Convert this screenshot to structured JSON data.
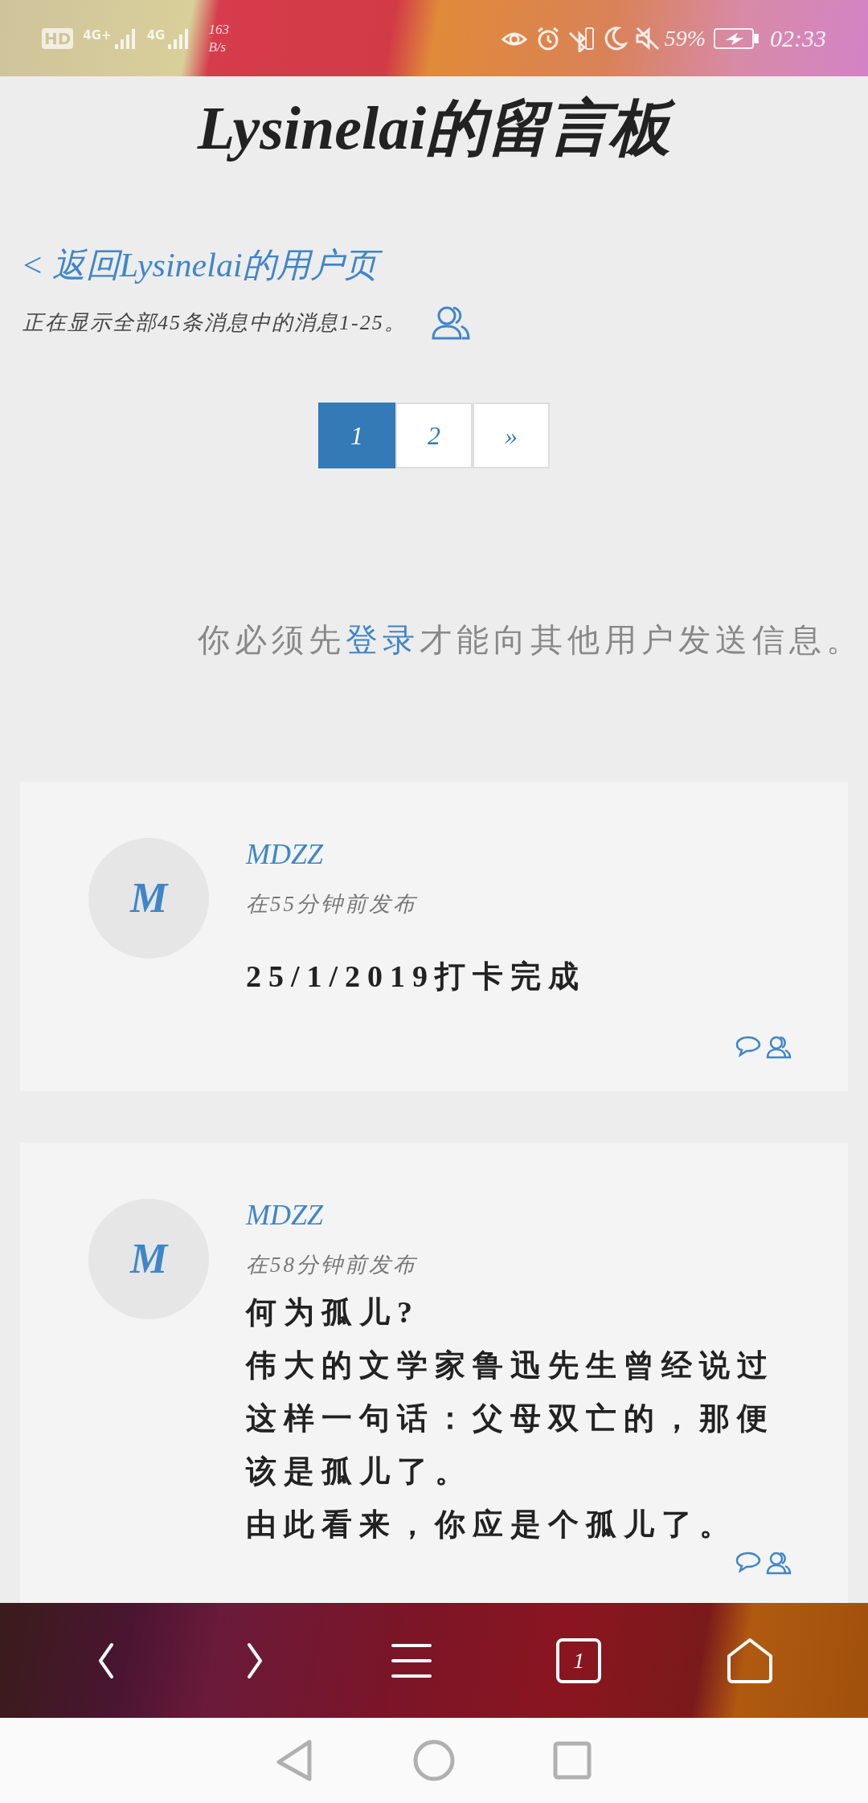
{
  "status_bar": {
    "hd": "HD",
    "signals": [
      "4G+",
      "4G"
    ],
    "speed": "163",
    "speed_unit": "B/s",
    "battery": "59%",
    "time": "02:33"
  },
  "page": {
    "title": "Lysinelai的留言板",
    "back_link": "< 返回Lysinelai的用户页",
    "info": "正在显示全部45条消息中的消息1-25。",
    "pagination": [
      {
        "label": "1",
        "selected": true
      },
      {
        "label": "2",
        "selected": false
      },
      {
        "label": "»",
        "selected": false
      }
    ],
    "login_notice": {
      "before": "你必须先",
      "link": "登录",
      "after": "才能向其他用户发送信息。"
    }
  },
  "messages": [
    {
      "avatar": "M",
      "author": "MDZZ",
      "time": "在55分钟前发布",
      "lines": [
        "25/1/2019打卡完成"
      ]
    },
    {
      "avatar": "M",
      "author": "MDZZ",
      "time": "在58分钟前发布",
      "lines": [
        "何为孤儿?",
        "伟大的文学家鲁迅先生曾经说过",
        "这样一句话：父母双亡的，那便",
        "该是孤儿了。",
        "由此看来，你应是个孤儿了。"
      ]
    }
  ],
  "browser_bar": {
    "tab_count": "1"
  }
}
